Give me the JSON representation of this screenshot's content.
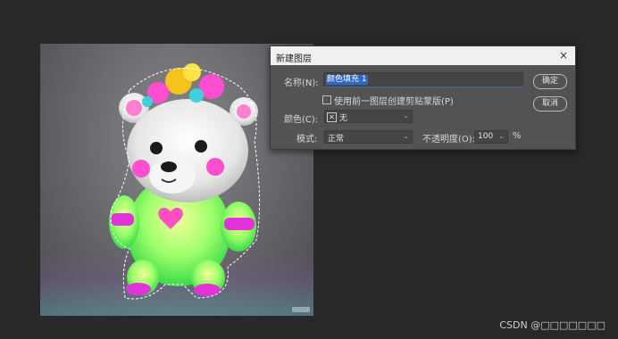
{
  "dialog": {
    "title": "新建图层",
    "close_glyph": "×",
    "name_label": "名称(N):",
    "name_value": "颜色填充 1",
    "clip_label": "使用前一图层创建剪贴蒙版(P)",
    "color_label": "颜色(C):",
    "color_value": "无",
    "mode_label": "模式:",
    "mode_value": "正常",
    "opacity_label": "不透明度(O):",
    "opacity_value": "100",
    "opacity_unit": "%",
    "ok_label": "确定",
    "cancel_label": "取消"
  },
  "icons": {
    "close": "close-icon",
    "chevron": "chevron-down-icon",
    "color_swatch": "no-color-swatch-icon"
  },
  "colors": {
    "app_background": "#282828",
    "dialog_background": "#535353",
    "selection": "#2e68c6"
  },
  "footer": {
    "watermark": "CSDN @□□□□□□□"
  }
}
